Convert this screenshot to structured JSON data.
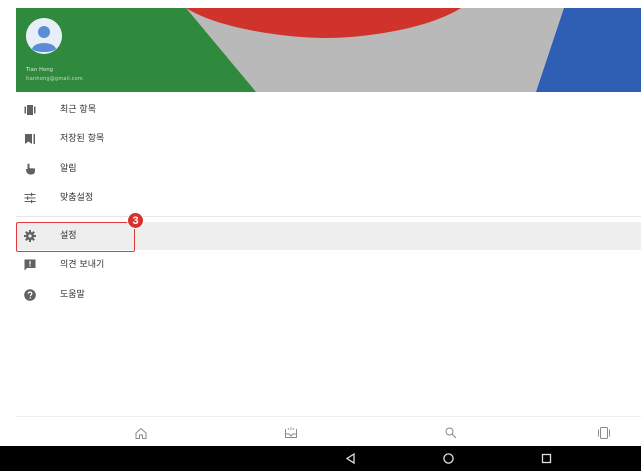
{
  "header": {
    "account_name": "Tian Hong",
    "account_email": "tianhong@gmail.com",
    "avatar_icon": "person-avatar-icon",
    "colors": {
      "red": "#d0332b",
      "green": "#2f8a3e",
      "blue": "#2f5fb5",
      "grey": "#b8b8b8"
    }
  },
  "menu": {
    "items": [
      {
        "label": "최근 항목",
        "icon": "recent-tabs-icon"
      },
      {
        "label": "저장된 항목",
        "icon": "bookmark-icon"
      },
      {
        "label": "알림",
        "icon": "touch-hand-icon"
      },
      {
        "label": "맞춤설정",
        "icon": "tune-sliders-icon"
      },
      {
        "label": "설정",
        "icon": "gear-icon"
      },
      {
        "label": "의견 보내기",
        "icon": "feedback-icon"
      },
      {
        "label": "도움말",
        "icon": "help-icon"
      }
    ]
  },
  "annotation": {
    "step": "3",
    "color": "#d9302c"
  },
  "bottom_nav": {
    "items": [
      {
        "icon": "home-icon"
      },
      {
        "icon": "inbox-tray-icon"
      },
      {
        "icon": "search-icon"
      },
      {
        "icon": "tabs-icon"
      }
    ]
  },
  "system_bar": {
    "items": [
      {
        "icon": "back-triangle-icon"
      },
      {
        "icon": "home-circle-icon"
      },
      {
        "icon": "recents-square-icon"
      }
    ]
  }
}
